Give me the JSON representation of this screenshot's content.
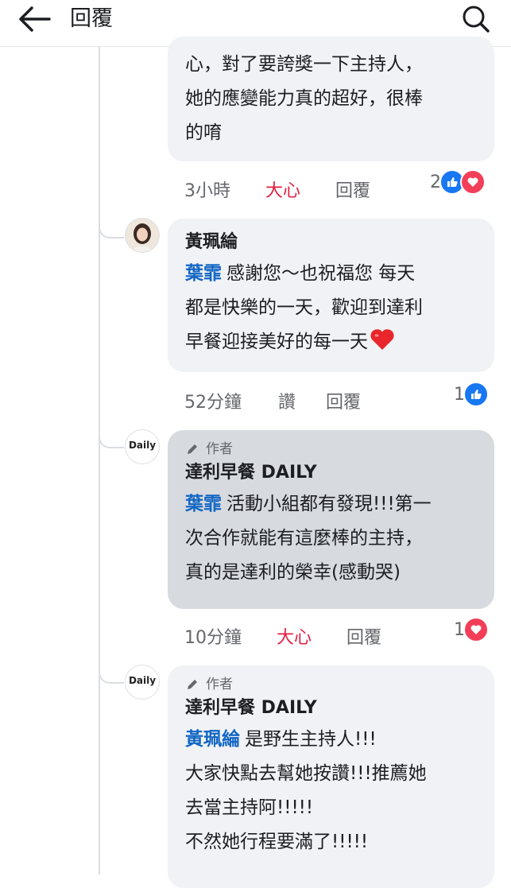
{
  "header": {
    "title": "回覆",
    "back_icon": "arrow-left-icon",
    "search_icon": "search-icon"
  },
  "colors": {
    "link": "#1266c4",
    "love": "#e41e3f",
    "like": "#1877f2",
    "heart": "#f33e58",
    "highlight": "#d7dadf"
  },
  "comments": [
    {
      "lines": [
        "心，對了要誇獎一下主持人，",
        "她的應變能力真的超好，很棒",
        "的唷"
      ],
      "time": "3小時",
      "reaction_action": "大心",
      "reply": "回覆",
      "reaction_count": "2",
      "reaction_icons": [
        "like-icon",
        "heart-icon"
      ]
    },
    {
      "author": "黃珮綸",
      "mention": "葉霏",
      "lines": [
        "感謝您～也祝福您 每天",
        "都是快樂的一天，歡迎到達利",
        "早餐迎接美好的每一天"
      ],
      "emoji": "❤️",
      "time": "52分鐘",
      "reaction_action": "讚",
      "reply": "回覆",
      "reaction_count": "1",
      "reaction_icons": [
        "like-icon"
      ]
    },
    {
      "author_badge": "作者",
      "author": "達利早餐 DAILY",
      "avatar_text": "Daily",
      "mention": "葉霏",
      "lines": [
        "活動小組都有發現!!!第一",
        "次合作就能有這麼棒的主持，",
        "真的是達利的榮幸(感動哭)"
      ],
      "time": "10分鐘",
      "reaction_action": "大心",
      "reply": "回覆",
      "reaction_count": "1",
      "reaction_icons": [
        "heart-icon"
      ]
    },
    {
      "author_badge": "作者",
      "author": "達利早餐 DAILY",
      "avatar_text": "Daily",
      "mention": "黃珮綸",
      "lines": [
        "是野生主持人!!!",
        "大家快點去幫她按讚!!!推薦她",
        "去當主持阿!!!!!",
        "不然她行程要滿了!!!!!"
      ]
    }
  ]
}
